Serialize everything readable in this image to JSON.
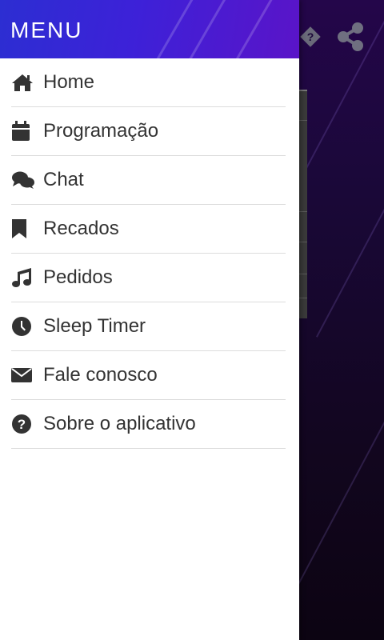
{
  "drawer": {
    "title": "MENU",
    "items": [
      {
        "label": "Home",
        "icon": "home-icon"
      },
      {
        "label": "Programação",
        "icon": "calendar-icon"
      },
      {
        "label": "Chat",
        "icon": "chat-bubbles-icon"
      },
      {
        "label": "Recados",
        "icon": "bookmark-icon"
      },
      {
        "label": "Pedidos",
        "icon": "music-note-icon"
      },
      {
        "label": "Sleep Timer",
        "icon": "clock-icon"
      },
      {
        "label": "Fale conosco",
        "icon": "envelope-icon"
      },
      {
        "label": "Sobre o aplicativo",
        "icon": "question-circle-icon"
      }
    ]
  },
  "background_app": {
    "top_icons": [
      "help-diamond-icon",
      "share-icon"
    ]
  },
  "colors": {
    "header_gradient_start": "#2c2ed2",
    "header_gradient_end": "#5a14c8",
    "item_text": "#333333",
    "divider": "#dcdcdc",
    "background_purple": "#1a0838"
  }
}
